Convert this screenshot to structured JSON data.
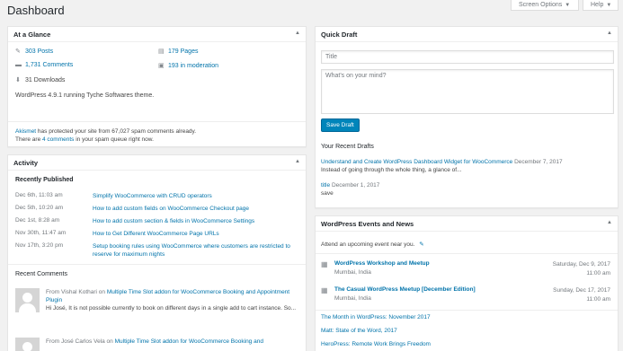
{
  "page": {
    "title": "Dashboard"
  },
  "top": {
    "screen_options": "Screen Options",
    "help": "Help"
  },
  "glance": {
    "title": "At a Glance",
    "posts": "303 Posts",
    "pages": "179 Pages",
    "comments": "1,731 Comments",
    "moderation": "193 in moderation",
    "downloads": "31 Downloads",
    "version": "WordPress 4.9.1 running Tyche Softwares theme.",
    "akismet_link": "Akismet",
    "akismet_text": " has protected your site from 67,027 spam comments already.",
    "spam_pre": "There are ",
    "spam_link": "4 comments",
    "spam_post": " in your spam queue right now."
  },
  "activity": {
    "title": "Activity",
    "recent_published": "Recently Published",
    "published": [
      {
        "date": "Dec 6th, 11:03 am",
        "title": "Simplify WooCommerce with CRUD operators"
      },
      {
        "date": "Dec 5th, 10:20 am",
        "title": "How to add custom fields on WooCommerce Checkout page"
      },
      {
        "date": "Dec 1st, 8:28 am",
        "title": "How to add custom section & fields in WooCommerce Settings"
      },
      {
        "date": "Nov 30th, 11:47 am",
        "title": "How to Get Different WooCommerce Page URLs"
      },
      {
        "date": "Nov 17th, 3:20 pm",
        "title": "Setup booking rules using WooCommerce where customers are restricted to reserve for maximum nights"
      }
    ],
    "recent_comments": "Recent Comments",
    "comments": [
      {
        "from": "From Vishal Kothari on ",
        "post": "Multiple Time Slot addon for WooCommerce Booking and Appointment Plugin",
        "text": "Hi José, It is not possible currently to book on different days in a single add to cart instance. So..."
      },
      {
        "from": "From José Carlos Vela on ",
        "post": "Multiple Time Slot addon for WooCommerce Booking and",
        "text": ""
      }
    ]
  },
  "quick_draft": {
    "title": "Quick Draft",
    "title_placeholder": "Title",
    "content_placeholder": "What's on your mind?",
    "save_button": "Save Draft",
    "recent_drafts": "Your Recent Drafts",
    "drafts": [
      {
        "title": "Understand and Create WordPress Dashboard Widget for WooCommerce",
        "date": "December 7, 2017",
        "excerpt": "Instead of going through the whole thing, a glance of..."
      },
      {
        "title": "title",
        "date": "December 1, 2017",
        "excerpt": "save"
      }
    ]
  },
  "events": {
    "title": "WordPress Events and News",
    "attend": "Attend an upcoming event near you.",
    "items": [
      {
        "name": "WordPress Workshop and Meetup",
        "location": "Mumbai, India",
        "date": "Saturday, Dec 9, 2017",
        "time": "11:00 am"
      },
      {
        "name": "The Casual WordPress Meetup [December Edition]",
        "location": "Mumbai, India",
        "date": "Sunday, Dec 17, 2017",
        "time": "11:00 am"
      }
    ],
    "news": [
      "The Month in WordPress: November 2017",
      "Matt: State of the Word, 2017",
      "HeroPress: Remote Work Brings Freedom"
    ]
  },
  "icons": {
    "posts": "pushpin-icon",
    "pages": "pages-icon",
    "comments": "comment-bubble-icon",
    "moderation": "comments-moderation-icon",
    "downloads": "download-icon",
    "event": "calendar-meetup-icon",
    "location": "pencil-edit-icon"
  },
  "colors": {
    "accent": "#0073aa",
    "button": "#0085ba",
    "background": "#f1f1f1"
  }
}
